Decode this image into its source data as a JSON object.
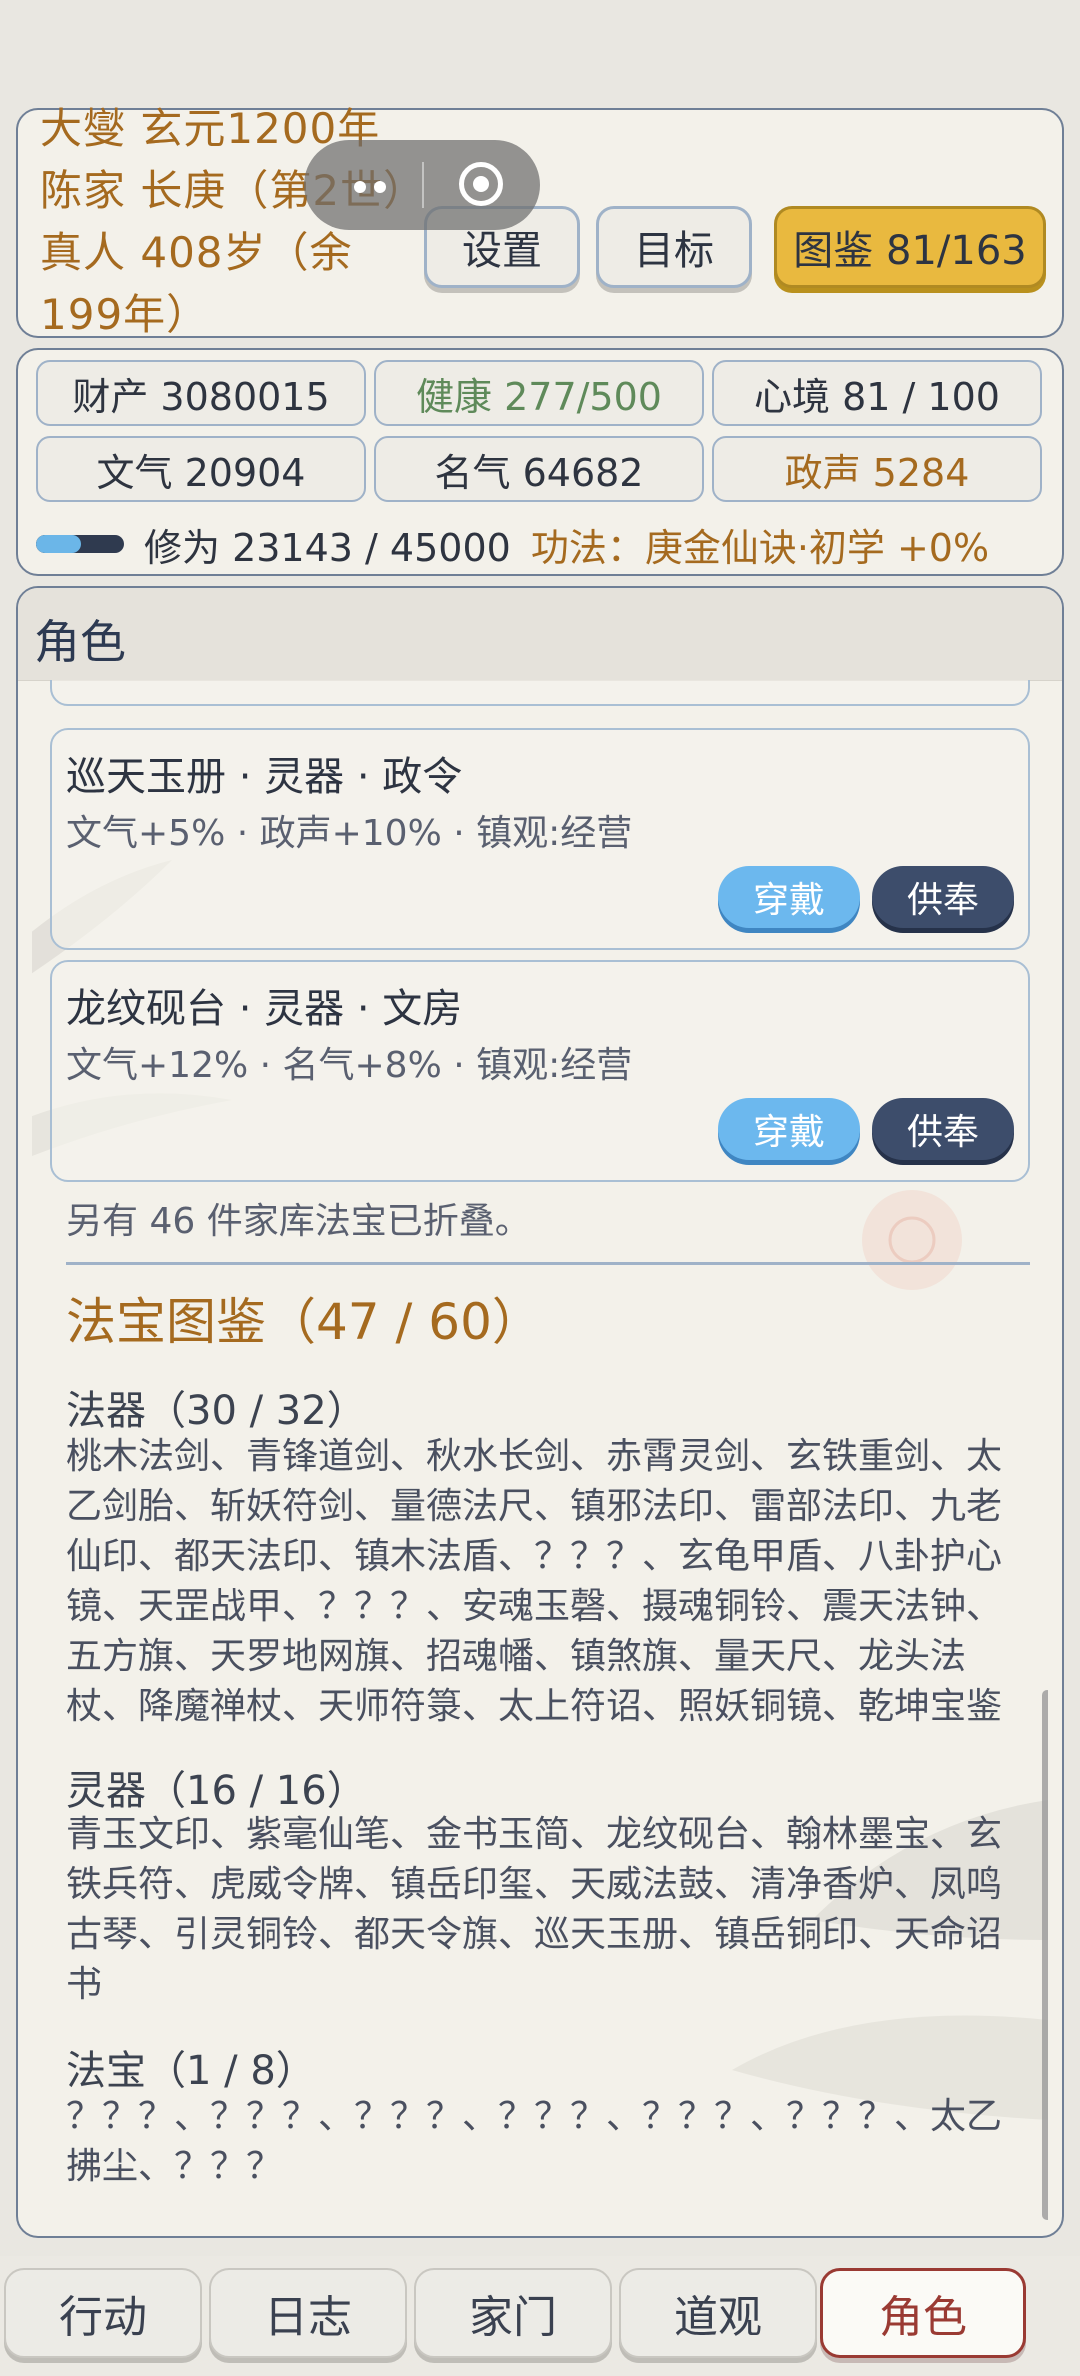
{
  "header": {
    "title": "大燮 玄元1200年 陈家 长庚（第2世）真人 408岁（余199年）",
    "buttons": {
      "settings": "设置",
      "goals": "目标",
      "atlas": "图鉴 81/163"
    }
  },
  "stats": {
    "wealth": "财产 3080015",
    "health": "健康 277/500",
    "mind": "心境 81 / 100",
    "literary": "文气 20904",
    "fame": "名气 64682",
    "reputation": "政声 5284",
    "cultivation": "修为 23143 / 45000",
    "cultivation_progress": 0.514,
    "technique": "功法：庚金仙诀·初学 +0%"
  },
  "main": {
    "title": "角色",
    "partial_buttons": {
      "wear": "穿戴",
      "offer": "供奉"
    },
    "items": [
      {
        "name": "巡天玉册 · 灵器 · 政令",
        "effect": "文气+5% · 政声+10% · 镇观:经营",
        "wear": "穿戴",
        "offer": "供奉"
      },
      {
        "name": "龙纹砚台 · 灵器 · 文房",
        "effect": "文气+12% · 名气+8% · 镇观:经营",
        "wear": "穿戴",
        "offer": "供奉"
      }
    ],
    "folded_note": "另有 46 件家库法宝已折叠。",
    "atlas_title": "法宝图鉴（47 / 60）",
    "categories": [
      {
        "title": "法器（30 / 32）",
        "items": "桃木法剑、青锋道剑、秋水长剑、赤霄灵剑、玄铁重剑、太乙剑胎、斩妖符剑、量德法尺、镇邪法印、雷部法印、九老仙印、都天法印、镇木法盾、？？？、玄龟甲盾、八卦护心镜、天罡战甲、？？？、安魂玉磬、摄魂铜铃、震天法钟、五方旗、天罗地网旗、招魂幡、镇煞旗、量天尺、龙头法杖、降魔禅杖、天师符箓、太上符诏、照妖铜镜、乾坤宝鉴"
      },
      {
        "title": "灵器（16 / 16）",
        "items": "青玉文印、紫毫仙笔、金书玉简、龙纹砚台、翰林墨宝、玄铁兵符、虎威令牌、镇岳印玺、天威法鼓、清净香炉、凤鸣古琴、引灵铜铃、都天令旗、巡天玉册、镇岳铜印、天命诏书"
      },
      {
        "title": "法宝（1 / 8）",
        "items": "？？？、？？？、？？？、？？？、？？？、？？？、太乙拂尘、？？？"
      }
    ]
  },
  "nav": {
    "tabs": [
      "行动",
      "日志",
      "家门",
      "道观",
      "角色"
    ],
    "active": "角色"
  }
}
